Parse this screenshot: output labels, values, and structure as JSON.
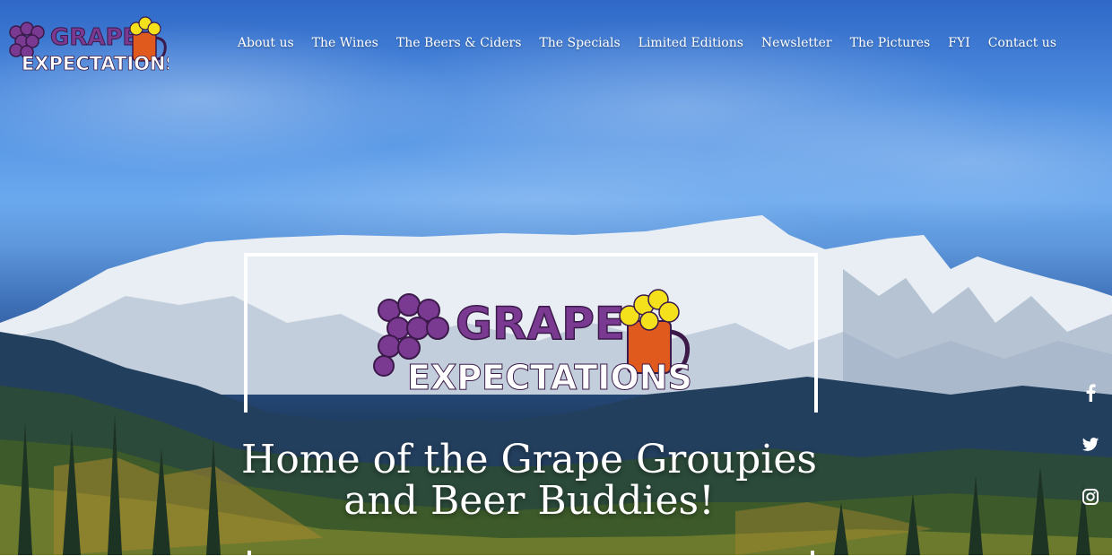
{
  "brand": {
    "name_line1": "GRAPE",
    "name_line2": "EXPECTATIONS",
    "colors": {
      "purple": "#7a3a92",
      "grape": "#6d2f87",
      "white": "#ffffff",
      "beer_orange": "#e05a1e",
      "foam_yellow": "#f5e11b"
    }
  },
  "nav": {
    "items": [
      {
        "label": "About us"
      },
      {
        "label": "The Wines"
      },
      {
        "label": "The Beers & Ciders"
      },
      {
        "label": "The Specials"
      },
      {
        "label": "Limited Editions"
      },
      {
        "label": "Newsletter"
      },
      {
        "label": "The Pictures"
      },
      {
        "label": "FYI"
      },
      {
        "label": "Contact us"
      }
    ]
  },
  "hero": {
    "headline_line1": "Home of the Grape Groupies",
    "headline_line2": "and Beer Buddies!"
  },
  "social": {
    "icons": [
      "facebook-icon",
      "twitter-icon",
      "instagram-icon"
    ]
  }
}
